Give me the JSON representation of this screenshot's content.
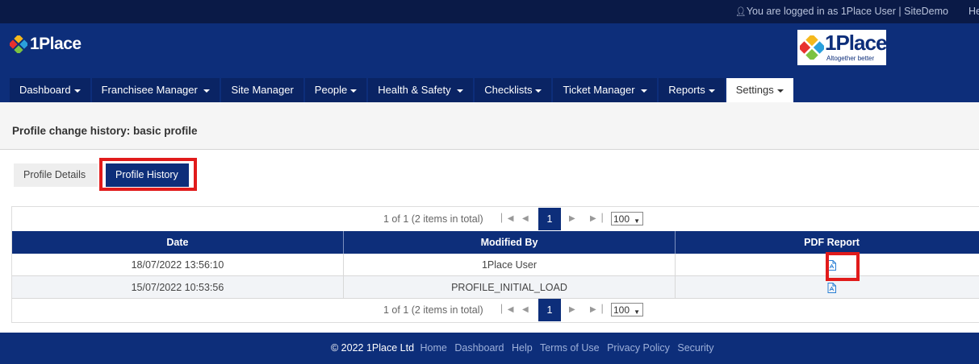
{
  "topbar": {
    "login_text": "You are logged in as  1Place User | SiteDemo",
    "help": "He"
  },
  "brand": {
    "name": "1Place",
    "logo_name": "1Place",
    "logo_tagline": "Altogether better"
  },
  "nav": [
    {
      "label": "Dashboard",
      "caret": true
    },
    {
      "label": "Franchisee Manager",
      "caret": true
    },
    {
      "label": "Site Manager",
      "caret": false
    },
    {
      "label": "People",
      "caret": true
    },
    {
      "label": "Health & Safety",
      "caret": true
    },
    {
      "label": "Checklists",
      "caret": true
    },
    {
      "label": "Ticket Manager",
      "caret": true
    },
    {
      "label": "Reports",
      "caret": true
    },
    {
      "label": "Settings",
      "caret": true,
      "active": true
    }
  ],
  "page_title": "Profile change history: basic profile",
  "subtabs": {
    "details": "Profile Details",
    "history": "Profile History"
  },
  "pager": {
    "info": "1 of 1 (2 items in total)",
    "page": "1",
    "page_size": "100"
  },
  "table": {
    "columns": [
      "Date",
      "Modified By",
      "PDF Report"
    ],
    "rows": [
      {
        "date": "18/07/2022 13:56:10",
        "modified_by": "1Place User"
      },
      {
        "date": "15/07/2022 10:53:56",
        "modified_by": "PROFILE_INITIAL_LOAD"
      }
    ]
  },
  "footer": {
    "copyright": "© 2022 1Place Ltd",
    "links": [
      "Home",
      "Dashboard",
      "Help",
      "Terms of Use",
      "Privacy Policy",
      "Security"
    ]
  },
  "colors": {
    "navy": "#0d2e7a",
    "dark_navy": "#0a1a47",
    "highlight": "#e11b1b",
    "pdf_blue": "#2a7fd4"
  }
}
